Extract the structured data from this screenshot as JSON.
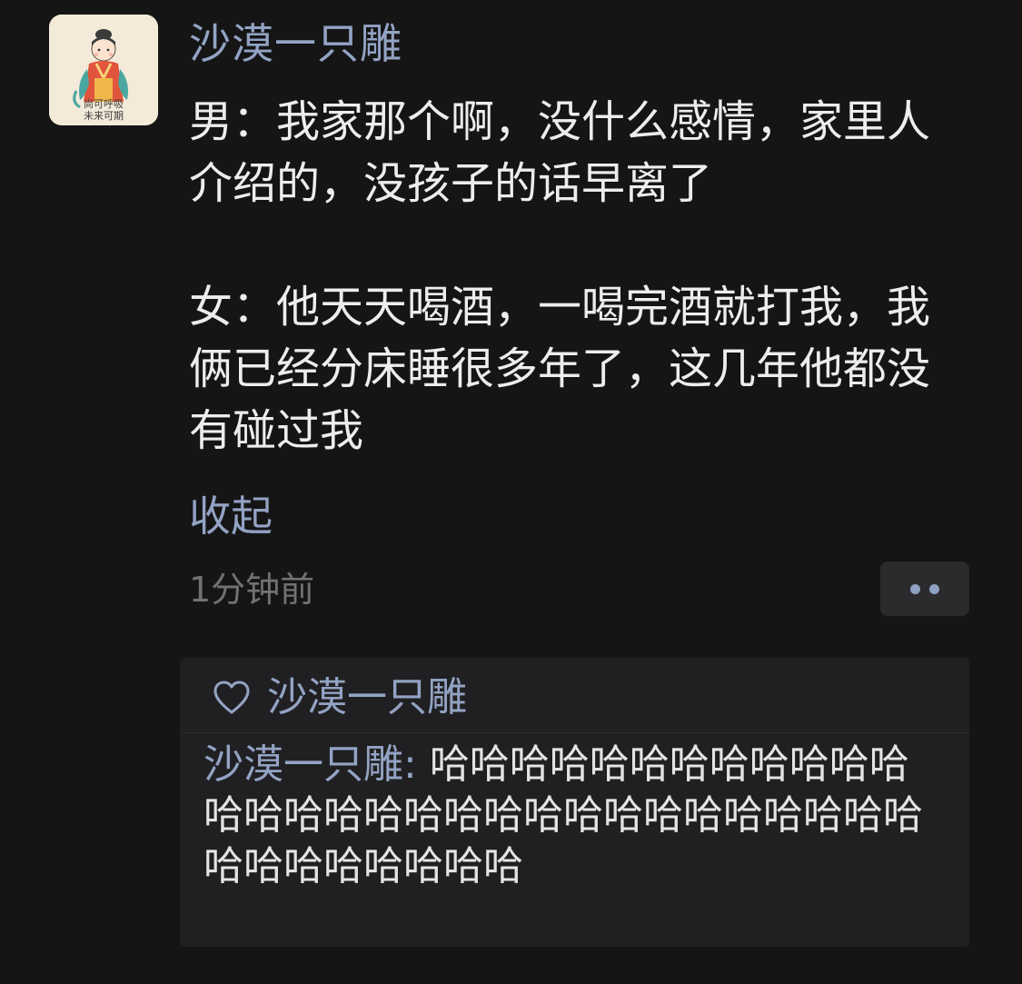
{
  "post": {
    "username": "沙漠一只雕",
    "paragraph_1": "男：我家那个啊，没什么感情，家里人介绍的，没孩子的话早离了",
    "paragraph_2": "女：他天天喝酒，一喝完酒就打我，我俩已经分床睡很多年了，这几年他都没有碰过我",
    "collapse_label": "收起",
    "timestamp": "1分钟前",
    "more_icon": "more-dots-icon",
    "avatar_text_line1": "尚可呼吸",
    "avatar_text_line2": "未来可期"
  },
  "interactions": {
    "like_icon": "heart-outline-icon",
    "likes": [
      "沙漠一只雕"
    ],
    "comments": [
      {
        "author": "沙漠一只雕",
        "separator": ": ",
        "text": "哈哈哈哈哈哈哈哈哈哈哈哈哈哈哈哈哈哈哈哈哈哈哈哈哈哈哈哈哈哈哈哈哈哈哈哈哈哈"
      }
    ]
  },
  "colors": {
    "background": "#151516",
    "name_link": "#93a3c4",
    "body_text": "#ededed",
    "timestamp": "#727274",
    "panel": "#202022"
  }
}
